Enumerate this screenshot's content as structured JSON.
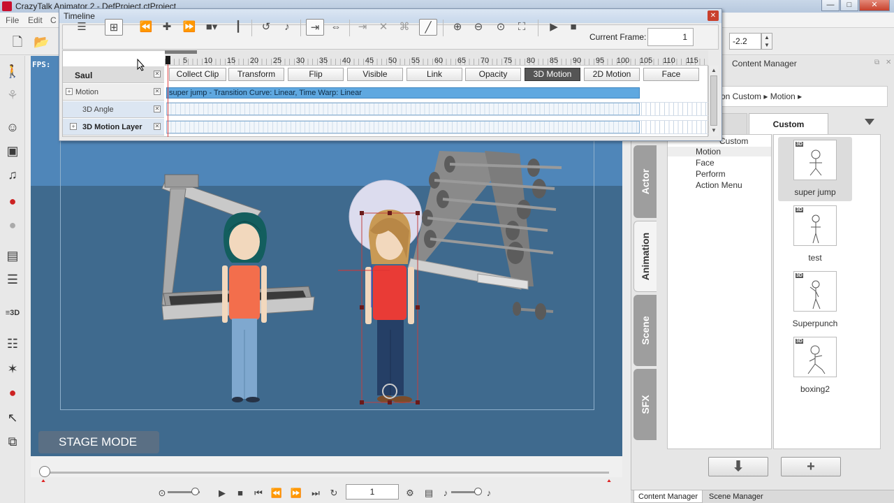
{
  "window": {
    "title": "CrazyTalk Animator 2 - DefProject.ctProject",
    "minimize": "—",
    "maximize": "□",
    "close": "✕"
  },
  "menu": [
    "File",
    "Edit",
    "C"
  ],
  "toolbar": {
    "value": "-2.2",
    "spin_up": "▲",
    "spin_down": "▼"
  },
  "stage": {
    "fps_label": "FPS:",
    "mode_label": "STAGE MODE"
  },
  "playback": {
    "current_frame": "1"
  },
  "timeline": {
    "title": "Timeline",
    "close": "✕",
    "current_frame_label": "Current Frame:",
    "current_frame": "1",
    "ruler_ticks": [
      "5",
      "10",
      "15",
      "20",
      "25",
      "30",
      "35",
      "40",
      "45",
      "50",
      "55",
      "60",
      "65",
      "70",
      "75",
      "80",
      "85",
      "90",
      "95",
      "100",
      "105",
      "110",
      "115"
    ],
    "owner": "Saul",
    "channel_buttons": [
      "Collect Clip",
      "Transform",
      "Flip",
      "Visible",
      "Link",
      "Opacity",
      "3D Motion",
      "2D Motion",
      "Face"
    ],
    "active_channel": "3D Motion",
    "tracks": [
      {
        "name": "Motion",
        "expandable": true
      },
      {
        "name": "3D Angle",
        "expandable": false
      },
      {
        "name": "3D Motion Layer",
        "expandable": true
      }
    ],
    "clip_label": "super jump - Transition Curve: Linear, Time Warp: Linear"
  },
  "content_manager": {
    "title": "Content Manager",
    "breadcrumb": "tion Custom ▸ Motion ▸",
    "tabs": [
      "Custom"
    ],
    "vertical_tabs": [
      "Actor",
      "Animation",
      "Scene",
      "SFX"
    ],
    "active_vertical_tab": "Animation",
    "tree_root": "Custom",
    "tree_nodes": [
      "Motion",
      "Face",
      "Perform",
      "Action Menu"
    ],
    "selected_node": "Motion",
    "items": [
      {
        "label": "super jump",
        "badge": "3D"
      },
      {
        "label": "test",
        "badge": "3D"
      },
      {
        "label": "Superpunch",
        "badge": "3D"
      },
      {
        "label": "boxing2",
        "badge": "3D"
      }
    ],
    "buttons": {
      "down": "⬇",
      "add": "+"
    }
  },
  "bottom_tabs": [
    "Content Manager",
    "Scene Manager"
  ],
  "colors": {
    "stage_sky": "#4f86b9",
    "stage_floor": "#3f6a8e",
    "clip": "#5fa8e0",
    "active_channel": "#555555"
  }
}
